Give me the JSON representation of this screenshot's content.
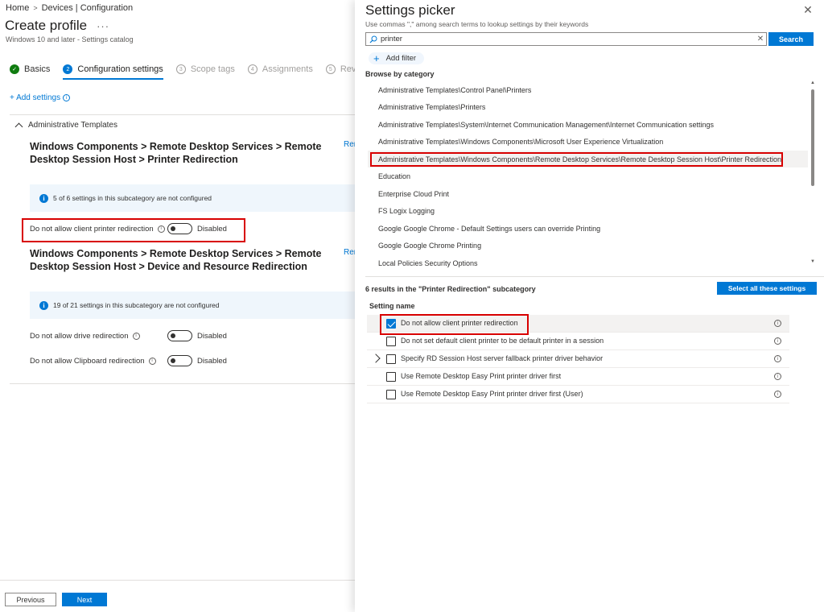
{
  "breadcrumb": {
    "home": "Home",
    "separator": ">",
    "current": "Devices | Configuration"
  },
  "page": {
    "title": "Create profile",
    "more": "···",
    "subtitle": "Windows 10 and later - Settings catalog"
  },
  "steps": [
    {
      "number": "✓",
      "label": "Basics",
      "state": "done"
    },
    {
      "number": "2",
      "label": "Configuration settings",
      "state": "active"
    },
    {
      "number": "3",
      "label": "Scope tags",
      "state": "pending"
    },
    {
      "number": "4",
      "label": "Assignments",
      "state": "pending"
    },
    {
      "number": "5",
      "label": "Review + c",
      "state": "pending"
    }
  ],
  "add_settings": "+ Add settings",
  "section": {
    "title": "Administrative Templates"
  },
  "subcategories": [
    {
      "title": "Windows Components > Remote Desktop Services > Remote Desktop Session Host > Printer Redirection",
      "remove": "Rer",
      "info": "5 of 6 settings in this subcategory are not configured",
      "settings": [
        {
          "name": "Do not allow client printer redirection",
          "state": "Disabled"
        }
      ]
    },
    {
      "title": "Windows Components > Remote Desktop Services > Remote Desktop Session Host > Device and Resource Redirection",
      "remove": "Rer",
      "info": "19 of 21 settings in this subcategory are not configured",
      "settings": [
        {
          "name": "Do not allow drive redirection",
          "state": "Disabled"
        },
        {
          "name": "Do not allow Clipboard redirection",
          "state": "Disabled"
        }
      ]
    }
  ],
  "footer": {
    "previous": "Previous",
    "next": "Next"
  },
  "picker": {
    "title": "Settings picker",
    "hint": "Use commas \",\" among search terms to lookup settings by their keywords",
    "close": "✕",
    "search_value": "printer",
    "search_button": "Search",
    "add_filter": "Add filter",
    "browse_label": "Browse by category",
    "categories": [
      "Administrative Templates\\Control Panel\\Printers",
      "Administrative Templates\\Printers",
      "Administrative Templates\\System\\Internet Communication Management\\Internet Communication settings",
      "Administrative Templates\\Windows Components\\Microsoft User Experience Virtualization",
      "Administrative Templates\\Windows Components\\Remote Desktop Services\\Remote Desktop Session Host\\Printer Redirection",
      "Education",
      "Enterprise Cloud Print",
      "FS Logix Logging",
      "Google Google Chrome - Default Settings users can override Printing",
      "Google Google Chrome Printing",
      "Local Policies Security Options"
    ],
    "selected_category_index": 4,
    "results_label": "6 results in the \"Printer Redirection\" subcategory",
    "select_all": "Select all these settings",
    "column_header": "Setting name",
    "results": [
      {
        "name": "Do not allow client printer redirection",
        "checked": true,
        "expandable": false
      },
      {
        "name": "Do not set default client printer to be default printer in a session",
        "checked": false,
        "expandable": false
      },
      {
        "name": "Specify RD Session Host server fallback printer driver behavior",
        "checked": false,
        "expandable": true
      },
      {
        "name": "Use Remote Desktop Easy Print printer driver first",
        "checked": false,
        "expandable": false
      },
      {
        "name": "Use Remote Desktop Easy Print printer driver first (User)",
        "checked": false,
        "expandable": false
      }
    ]
  },
  "colors": {
    "accent": "#0078d4",
    "success": "#107c10",
    "highlight": "#d80000",
    "info_bg": "#eff6fc"
  },
  "icons": {
    "search": "search-icon",
    "info": "info-icon",
    "close": "close-icon",
    "check": "checkmark-icon"
  }
}
